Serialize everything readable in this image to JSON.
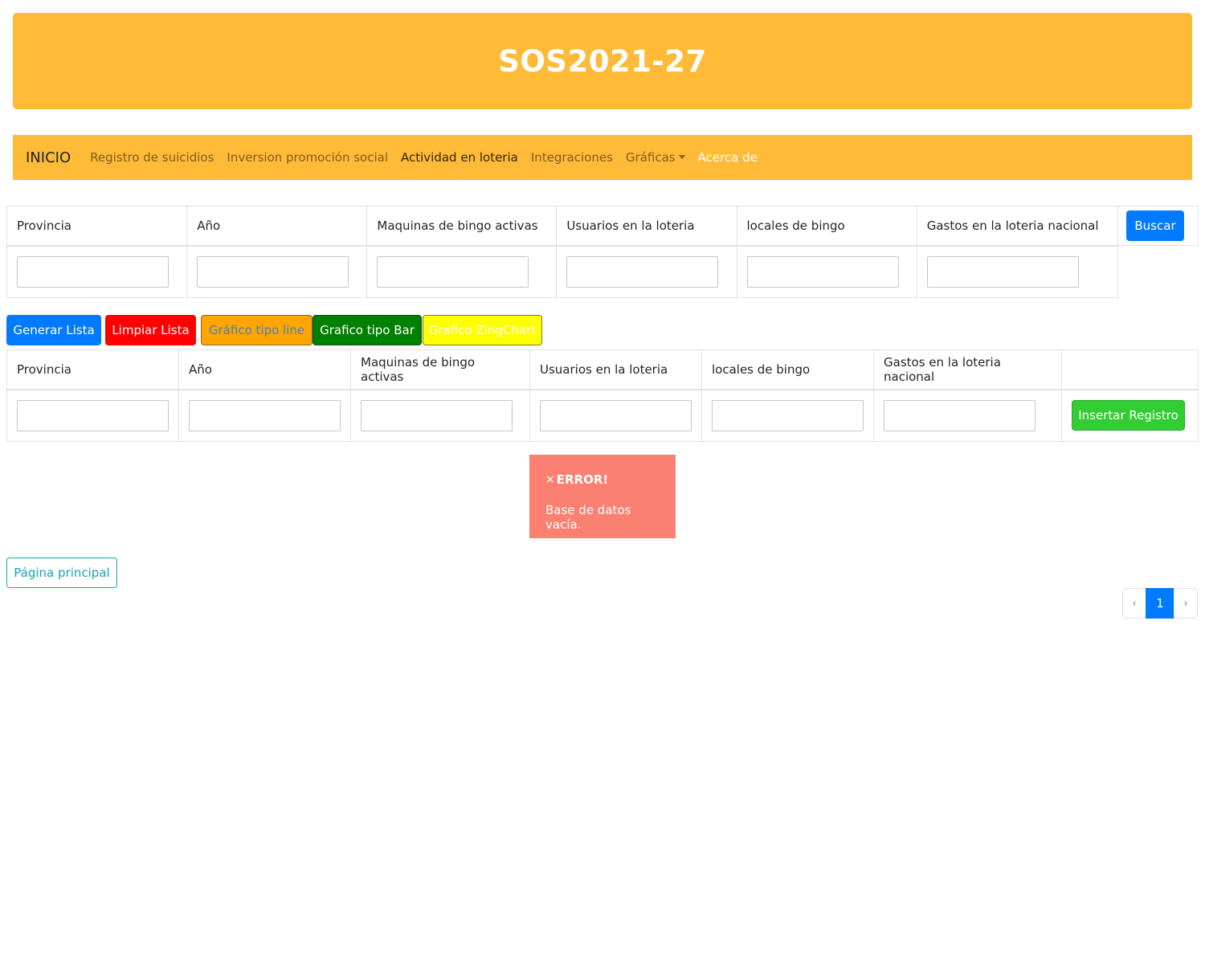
{
  "colors": {
    "brand": "#ffba37",
    "primary": "#007bff",
    "danger": "#ff0000",
    "line": "#ffa500",
    "line_text": "#4a7ebc",
    "bar": "#008000",
    "zing": "#ffff00",
    "alert": "#fa8072"
  },
  "header": {
    "title": "SOS2021-27"
  },
  "navbar": {
    "brand": "INICIO",
    "links": [
      "Registro de suicidios",
      "Inversion promoción social",
      "Actividad en loteria",
      "Integraciones",
      "Gráficas",
      "Acerca de"
    ]
  },
  "search": {
    "columns": [
      "Provincia",
      "Año",
      "Maquinas de bingo activas",
      "Usuarios en la loteria",
      "locales de bingo",
      "Gastos en la loteria nacional"
    ],
    "button": "Buscar"
  },
  "actions": {
    "generate": "Generar Lista",
    "clear": "Limpiar Lista",
    "line_chart": "Gráfico tipo line",
    "bar_chart": "Grafico tipo Bar",
    "zing_chart": "Grafico ZingChart"
  },
  "insert": {
    "columns": [
      "Provincia",
      "Año",
      "Maquinas de bingo activas",
      "Usuarios en la loteria",
      "locales de bingo",
      "Gastos en la loteria nacional"
    ],
    "button": "Insertar Registro"
  },
  "alert": {
    "close": "×",
    "title": "ERROR!",
    "message": "Base de datos vacía."
  },
  "home_button": "Página principal",
  "pagination": {
    "prev": "‹",
    "current": "1",
    "next": "›"
  }
}
